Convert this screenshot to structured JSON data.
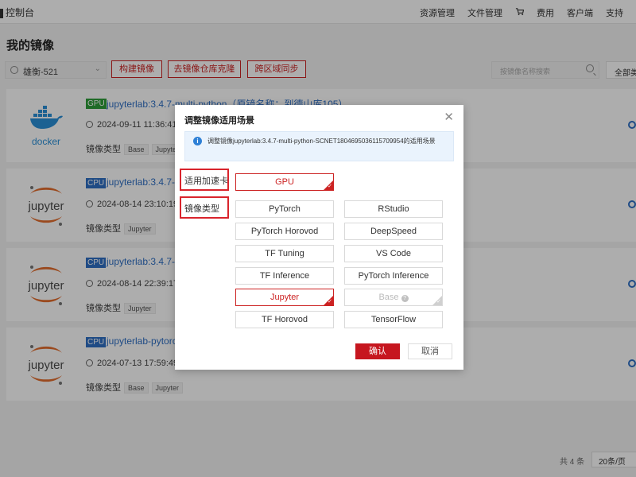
{
  "topbar": {
    "brand": "控制台",
    "nav": [
      "资源管理",
      "文件管理",
      "费用",
      "客户端",
      "支持"
    ]
  },
  "page": {
    "title": "我的镜像",
    "user_select": "雄衡-521",
    "buttons": [
      "构建镜像",
      "去镜像仓库克隆",
      "跨区域同步"
    ],
    "search_placeholder": "按镜像名称搜索",
    "status_select": "全部类"
  },
  "cards": [
    {
      "badge": "GPU",
      "name": "jupyterlab:3.4.7-multi-python（原镜名称：到德山库105）",
      "date": "2024-09-11 11:36:41",
      "type_label": "镜像类型",
      "tags": [
        "Base",
        "Jupyter"
      ],
      "logo": "docker"
    },
    {
      "badge": "CPU",
      "name": "jupyterlab:3.4.7-m",
      "date": "2024-08-14 23:10:19",
      "type_label": "镜像类型",
      "tags": [
        "Jupyter"
      ],
      "logo": "jupyter"
    },
    {
      "badge": "CPU",
      "name": "jupyterlab:3.4.7-m",
      "date": "2024-08-14 22:39:17",
      "type_label": "镜像类型",
      "tags": [
        "Jupyter"
      ],
      "logo": "jupyter"
    },
    {
      "badge": "CPU",
      "name": "jupyterlab-pytorch",
      "date": "2024-07-13 17:59:49",
      "type_label": "镜像类型",
      "tags": [
        "Base",
        "Jupyter"
      ],
      "logo": "jupyter"
    }
  ],
  "pagination": {
    "total": "共 4 条",
    "page_size": "20条/页"
  },
  "modal": {
    "title": "调整镜像适用场景",
    "info": "调整镜像jupyterlab:3.4.7-multi-python-SCNET1804695036115709954的适用场景",
    "accel_label": "适用加速卡",
    "type_label": "镜像类型",
    "accel_option": "GPU",
    "type_options": [
      {
        "label": "PyTorch",
        "state": "normal"
      },
      {
        "label": "RStudio",
        "state": "normal"
      },
      {
        "label": "PyTorch Horovod",
        "state": "normal"
      },
      {
        "label": "DeepSpeed",
        "state": "normal"
      },
      {
        "label": "TF Tuning",
        "state": "normal"
      },
      {
        "label": "VS Code",
        "state": "normal"
      },
      {
        "label": "TF Inference",
        "state": "normal"
      },
      {
        "label": "PyTorch Inference",
        "state": "normal"
      },
      {
        "label": "Jupyter",
        "state": "selected"
      },
      {
        "label": "Base",
        "state": "disabled"
      },
      {
        "label": "TF Horovod",
        "state": "normal"
      },
      {
        "label": "TensorFlow",
        "state": "normal"
      }
    ],
    "confirm": "确认",
    "cancel": "取消"
  },
  "colors": {
    "accent": "#c6161f",
    "link": "#2f6fc4",
    "gpu": "#2f9e3a",
    "cpu": "#2f6fc4"
  },
  "icons": [
    "cart-icon",
    "user-icon",
    "search-icon",
    "clock-icon",
    "close-icon",
    "info-icon",
    "help-icon",
    "check-icon",
    "docker-logo",
    "jupyter-logo"
  ]
}
